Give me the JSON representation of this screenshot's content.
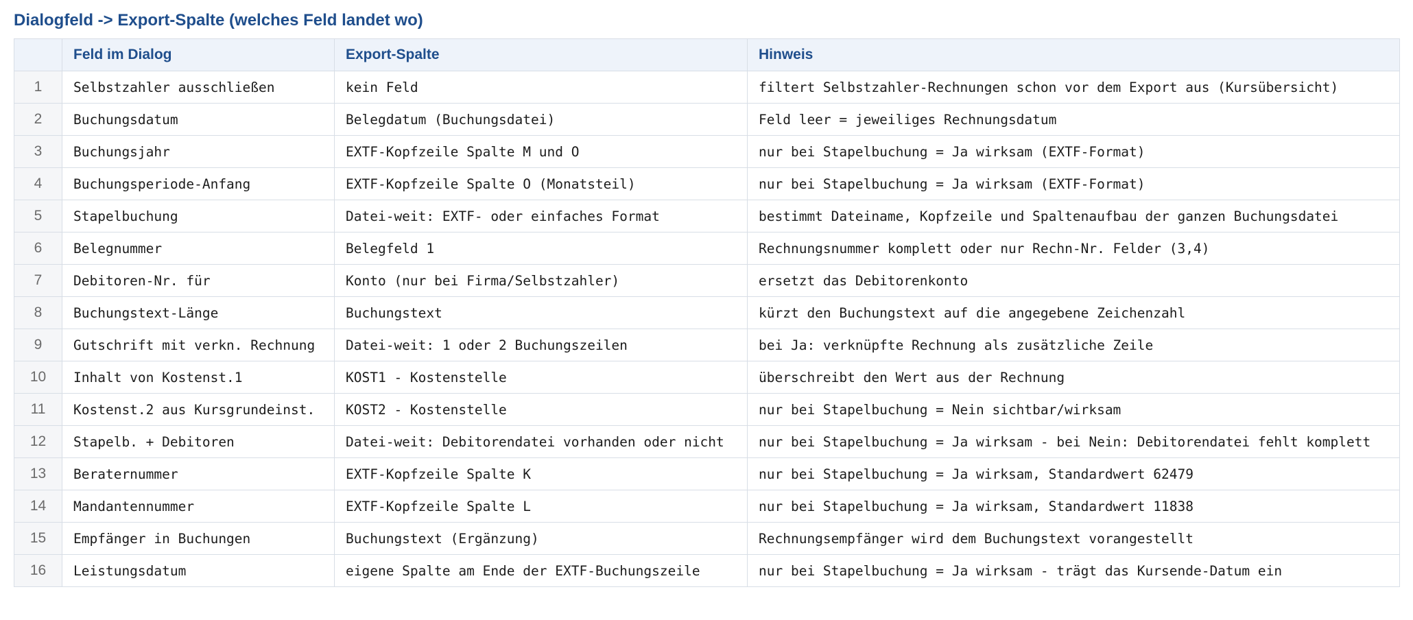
{
  "title": "Dialogfeld -> Export-Spalte (welches Feld landet wo)",
  "columns": [
    "",
    "Feld im Dialog",
    "Export-Spalte",
    "Hinweis"
  ],
  "rows": [
    [
      "1",
      "Selbstzahler ausschließen",
      "kein Feld",
      "filtert Selbstzahler-Rechnungen schon vor dem Export aus (Kursübersicht)"
    ],
    [
      "2",
      "Buchungsdatum",
      "Belegdatum (Buchungsdatei)",
      "Feld leer = jeweiliges Rechnungsdatum"
    ],
    [
      "3",
      "Buchungsjahr",
      "EXTF-Kopfzeile Spalte M und O",
      "nur bei Stapelbuchung = Ja wirksam (EXTF-Format)"
    ],
    [
      "4",
      "Buchungsperiode-Anfang",
      "EXTF-Kopfzeile Spalte O (Monatsteil)",
      "nur bei Stapelbuchung = Ja wirksam (EXTF-Format)"
    ],
    [
      "5",
      "Stapelbuchung",
      "Datei-weit: EXTF- oder einfaches Format",
      "bestimmt Dateiname, Kopfzeile und Spaltenaufbau der ganzen Buchungsdatei"
    ],
    [
      "6",
      "Belegnummer",
      "Belegfeld 1",
      "Rechnungsnummer komplett oder nur Rechn-Nr. Felder (3,4)"
    ],
    [
      "7",
      "Debitoren-Nr. für",
      "Konto (nur bei Firma/Selbstzahler)",
      "ersetzt das Debitorenkonto"
    ],
    [
      "8",
      "Buchungstext-Länge",
      "Buchungstext",
      "kürzt den Buchungstext auf die angegebene Zeichenzahl"
    ],
    [
      "9",
      "Gutschrift mit verkn. Rechnung",
      "Datei-weit: 1 oder 2 Buchungszeilen",
      "bei Ja: verknüpfte Rechnung als zusätzliche Zeile"
    ],
    [
      "10",
      "Inhalt von Kostenst.1",
      "KOST1 - Kostenstelle",
      "überschreibt den Wert aus der Rechnung"
    ],
    [
      "11",
      "Kostenst.2 aus Kursgrundeinst.",
      "KOST2 - Kostenstelle",
      "nur bei Stapelbuchung = Nein sichtbar/wirksam"
    ],
    [
      "12",
      "Stapelb. + Debitoren",
      "Datei-weit: Debitorendatei vorhanden oder nicht",
      "nur bei Stapelbuchung = Ja wirksam - bei Nein: Debitorendatei fehlt komplett"
    ],
    [
      "13",
      "Beraternummer",
      "EXTF-Kopfzeile Spalte K",
      "nur bei Stapelbuchung = Ja wirksam, Standardwert 62479"
    ],
    [
      "14",
      "Mandantennummer",
      "EXTF-Kopfzeile Spalte L",
      "nur bei Stapelbuchung = Ja wirksam, Standardwert 11838"
    ],
    [
      "15",
      "Empfänger in Buchungen",
      "Buchungstext (Ergänzung)",
      "Rechnungsempfänger wird dem Buchungstext vorangestellt"
    ],
    [
      "16",
      "Leistungsdatum",
      "eigene Spalte am Ende der EXTF-Buchungszeile",
      "nur bei Stapelbuchung = Ja wirksam - trägt das Kursende-Datum ein"
    ]
  ]
}
